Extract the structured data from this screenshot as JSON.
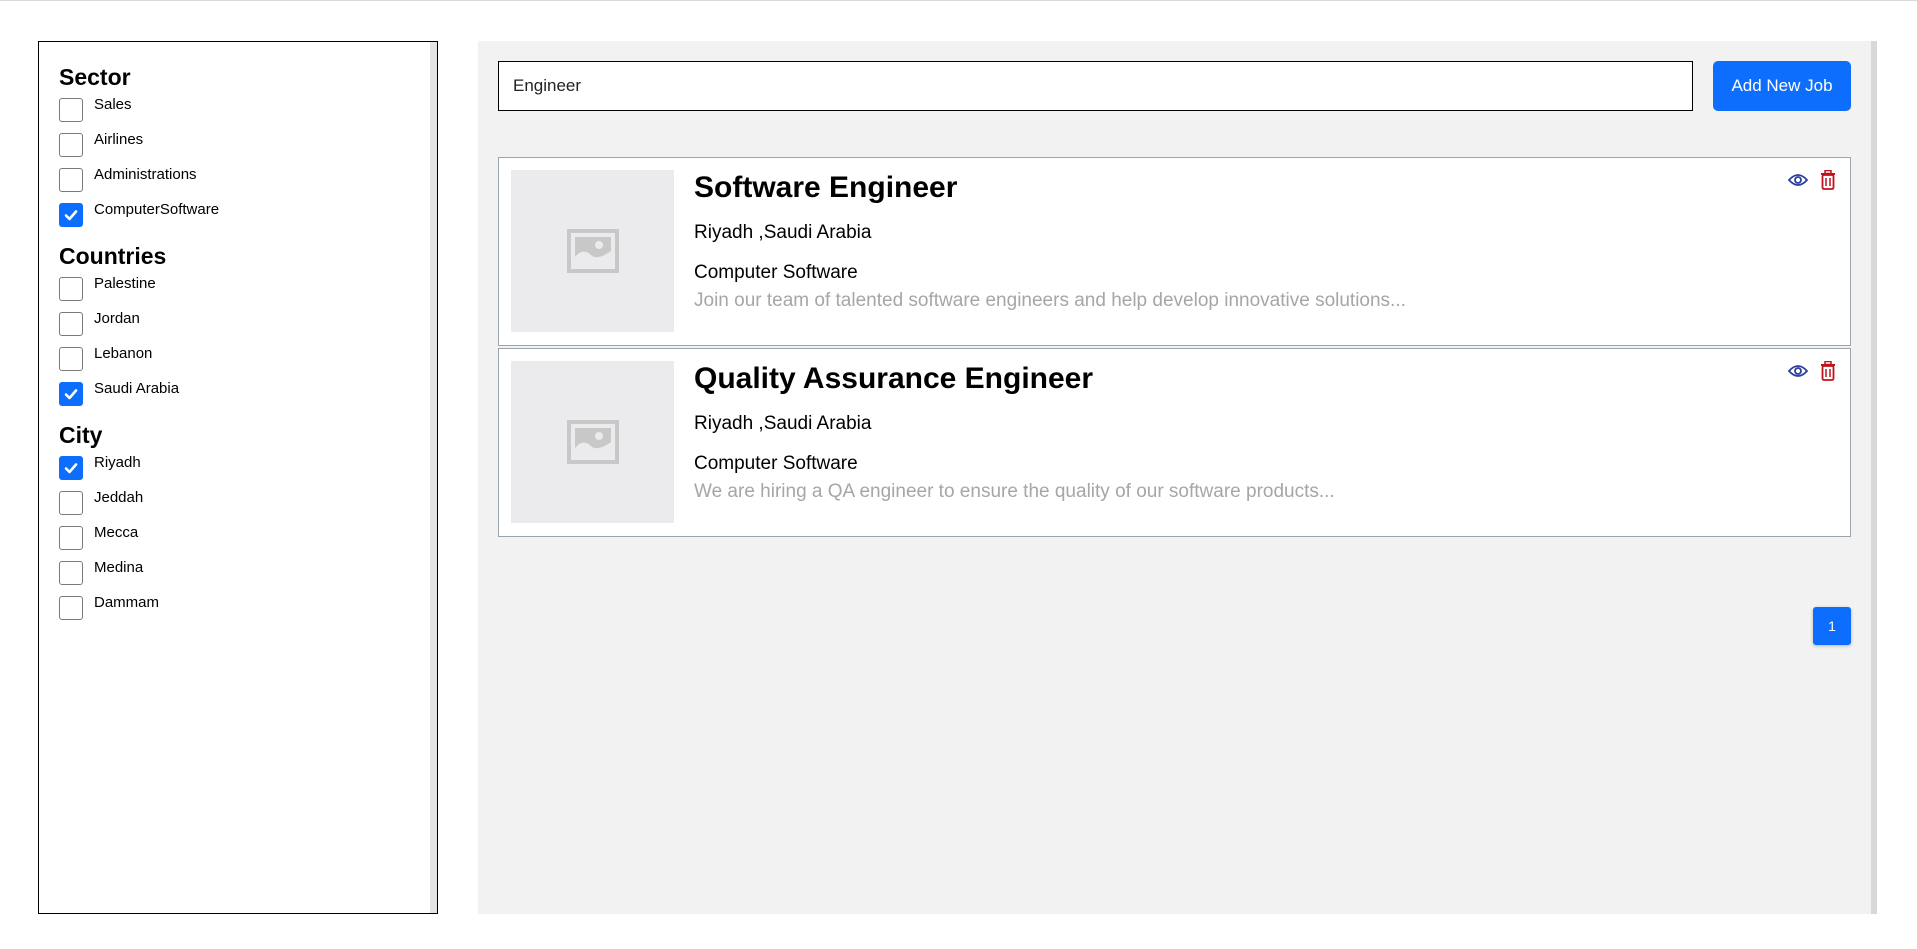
{
  "filters": {
    "sector": {
      "title": "Sector",
      "options": [
        {
          "label": "Sales",
          "checked": false
        },
        {
          "label": "Airlines",
          "checked": false
        },
        {
          "label": "Administrations",
          "checked": false
        },
        {
          "label": "ComputerSoftware",
          "checked": true
        }
      ]
    },
    "countries": {
      "title": "Countries",
      "options": [
        {
          "label": "Palestine",
          "checked": false
        },
        {
          "label": "Jordan",
          "checked": false
        },
        {
          "label": "Lebanon",
          "checked": false
        },
        {
          "label": "Saudi Arabia",
          "checked": true
        }
      ]
    },
    "city": {
      "title": "City",
      "options": [
        {
          "label": "Riyadh",
          "checked": true
        },
        {
          "label": "Jeddah",
          "checked": false
        },
        {
          "label": "Mecca",
          "checked": false
        },
        {
          "label": "Medina",
          "checked": false
        },
        {
          "label": "Dammam",
          "checked": false
        }
      ]
    }
  },
  "search": {
    "value": "Engineer"
  },
  "add_button_label": "Add New Job",
  "jobs": [
    {
      "title": "Software Engineer",
      "location": "Riyadh ,Saudi Arabia",
      "sector": "Computer Software",
      "description": "Join our team of talented software engineers and help develop innovative solutions..."
    },
    {
      "title": "Quality Assurance Engineer",
      "location": "Riyadh ,Saudi Arabia",
      "sector": "Computer Software",
      "description": "We are hiring a QA engineer to ensure the quality of our software products..."
    }
  ],
  "pagination": {
    "current_page": "1"
  },
  "icons": {
    "view": "eye-icon",
    "delete": "trash-icon",
    "thumbnail": "image-placeholder-icon",
    "check": "checkmark-icon"
  },
  "colors": {
    "accent": "#0d6efd",
    "view_icon": "#2c3e9e",
    "delete_icon": "#c0121b",
    "description_text": "#a6a6a6",
    "main_background": "#f2f2f2"
  }
}
